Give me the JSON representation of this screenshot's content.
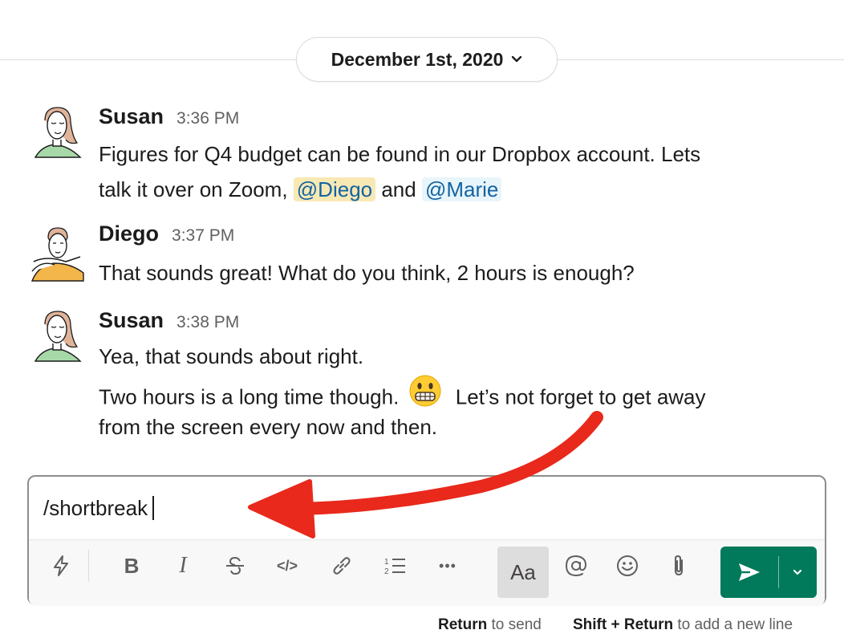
{
  "date_divider": {
    "label": "December 1st, 2020"
  },
  "messages": [
    {
      "author": "Susan",
      "time": "3:36 PM",
      "lines": [
        {
          "text": "Figures for Q4 budget can be found in our Dropbox account. Lets"
        },
        {
          "prefix": "talk it over on Zoom,",
          "mention1": "@Diego",
          "middle": "and",
          "mention2": "@Marie"
        }
      ]
    },
    {
      "author": "Diego",
      "time": "3:37 PM",
      "lines": [
        {
          "text": "That sounds great! What do you think, 2 hours is enough?"
        }
      ]
    },
    {
      "author": "Susan",
      "time": "3:38 PM",
      "lines": [
        {
          "text": "Yea, that sounds about right."
        },
        {
          "before_emoji": "Two hours is a long time though.",
          "after_emoji": "Let’s not forget to get away"
        },
        {
          "text": "from the screen every now and then."
        }
      ]
    }
  ],
  "composer": {
    "value": "/shortbreak",
    "toolbar": {
      "shortcuts_icon": "lightning-icon",
      "bold": "B",
      "italic": "I",
      "strike_icon": "strikethrough-icon",
      "code": "</>",
      "link_icon": "link-icon",
      "list_icon": "ordered-list-icon",
      "more": "•••",
      "format_toggle": "Aa",
      "mention_icon": "at-icon",
      "emoji_icon": "smiley-icon",
      "attach_icon": "paperclip-icon"
    },
    "send_icon": "send-icon",
    "send_options_icon": "chevron-down-icon"
  },
  "hints": {
    "return_key": "Return",
    "return_action": "to send",
    "shift_return_key": "Shift + Return",
    "shift_return_action": "to add a new line"
  },
  "colors": {
    "send_button": "#007a5a",
    "mention_self_bg": "#f8e8b4",
    "mention_other_bg": "#e8f5fa",
    "mention_text": "#1264a3",
    "annotation_arrow": "#e8291c"
  }
}
